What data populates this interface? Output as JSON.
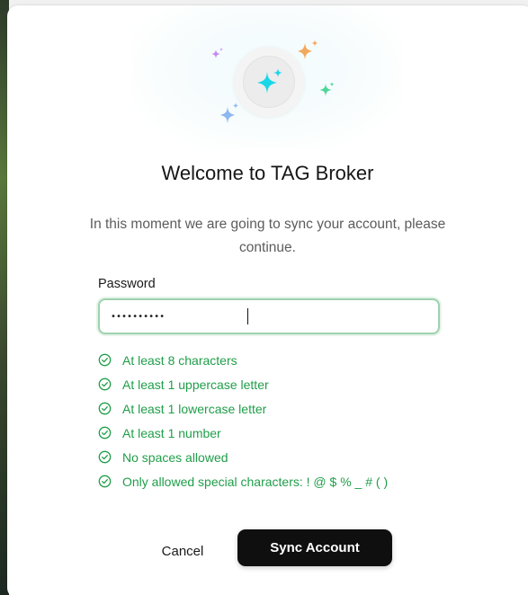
{
  "dialog": {
    "title": "Welcome to TAG Broker",
    "subtitle": "In this moment we are going to sync your account, please continue."
  },
  "password_field": {
    "label": "Password",
    "value": "••••••••••",
    "placeholder": ""
  },
  "requirements": [
    {
      "label": "At least 8 characters",
      "status": "met"
    },
    {
      "label": "At least 1 uppercase letter",
      "status": "met"
    },
    {
      "label": "At least 1 lowercase letter",
      "status": "met"
    },
    {
      "label": "At least 1 number",
      "status": "met"
    },
    {
      "label": "No spaces allowed",
      "status": "met"
    },
    {
      "label": "Only allowed special characters: ! @ $ % _ # ( )",
      "status": "met"
    }
  ],
  "actions": {
    "cancel_label": "Cancel",
    "sync_label": "Sync Account"
  },
  "icons": {
    "hero": "sparkles-icon",
    "requirement_check": "check-circle-icon"
  },
  "colors": {
    "success": "#1f9e49",
    "input_focus_border": "#9fd1ad",
    "primary_button": "#0f0f0f",
    "sparkle_cyan": "#18d7e8",
    "sparkle_orange": "#f3a85a",
    "sparkle_green": "#4fd69a",
    "sparkle_purple": "#c58af0",
    "sparkle_blue": "#8db8f0"
  }
}
